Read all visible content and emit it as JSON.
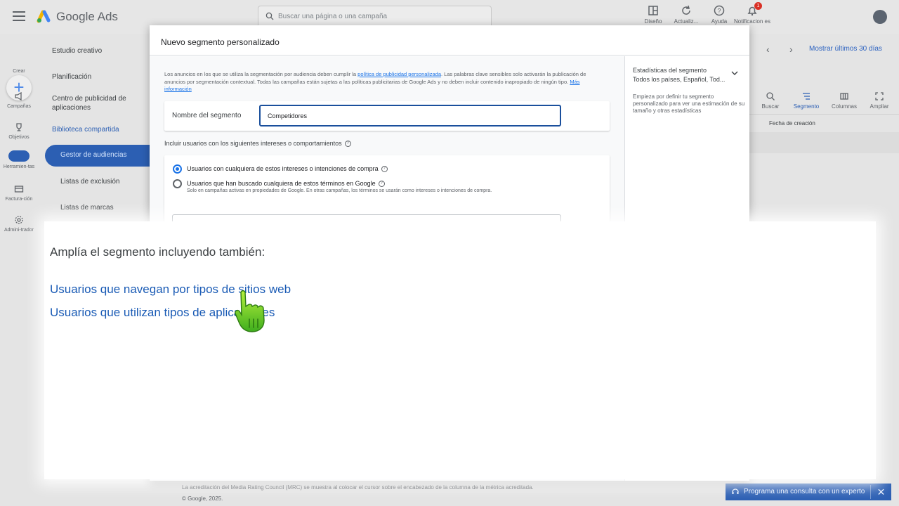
{
  "topbar": {
    "brand": "Google Ads",
    "search_placeholder": "Buscar una página o una campaña",
    "items": [
      {
        "label": "Diseño",
        "icon": "layout-icon"
      },
      {
        "label": "Actualiz...",
        "icon": "refresh-icon"
      },
      {
        "label": "Ayuda",
        "icon": "help-icon"
      },
      {
        "label": "Notificacion es",
        "icon": "bell-icon",
        "badge": "1"
      }
    ]
  },
  "rail": {
    "create": "Crear",
    "items": [
      {
        "label": "Campañas",
        "icon": "megaphone-icon"
      },
      {
        "label": "Objetivos",
        "icon": "trophy-icon"
      },
      {
        "label": "Herramien-tas",
        "icon": "tools-icon"
      },
      {
        "label": "Factura-ción",
        "icon": "credit-card-icon"
      },
      {
        "label": "Admini-trador",
        "icon": "gear-icon"
      }
    ]
  },
  "nav": {
    "studio": "Estudio creativo",
    "planning": "Planificación",
    "app_center_1": "Centro de publicidad de",
    "app_center_2": "aplicaciones",
    "shared_library": "Biblioteca compartida",
    "audience_manager": "Gestor de audiencias",
    "exclusion_lists": "Listas de exclusión",
    "brand_lists": "Listas de marcas"
  },
  "right": {
    "date_range": "Mostrar últimos 30 días",
    "tools": [
      "Buscar",
      "Segmento",
      "Columnas",
      "Ampliar"
    ],
    "column_header": "Fecha de creación"
  },
  "footer": {
    "line1": "La acreditación del Media Rating Council (MRC) se muestra al colocar el cursor sobre el encabezado de la columna de la métrica acreditada.",
    "line2": "© Google, 2025."
  },
  "consult": {
    "label": "Programa una consulta con un experto",
    "close": "✕"
  },
  "dialog": {
    "title": "Nuevo segmento personalizado",
    "policy": {
      "pre": "Los anuncios en los que se utiliza la segmentación por audiencia deben cumplir la ",
      "link1": "política de publicidad personalizada",
      "mid": ". Las palabras clave sensibles solo activarán la publicación de anuncios por segmentación contextual. Todas las campañas están sujetas a las políticas publicitarias de Google Ads y no deben incluir contenido inapropiado de ningún tipo. ",
      "link2": "Más información"
    },
    "name_label": "Nombre del segmento",
    "name_value": "Competidores",
    "include_label": "Incluir usuarios con los siguientes intereses o comportamientos",
    "option1": "Usuarios con cualquiera de estos intereses o intenciones de compra",
    "option2": "Usuarios que han buscado cualquiera de estos términos en Google",
    "option2_note": "Solo en campañas activas en propiedades de Google. En otras campañas, los términos se usarán como intereses o intenciones de compra.",
    "stats": {
      "title": "Estadísticas del segmento",
      "subtitle": "Todos los países, Español, Tod...",
      "description": "Empieza por definir tu segmento personalizado para ver una estimación de su tamaño y otras estadísticas"
    }
  },
  "zoom": {
    "title": "Amplía el segmento incluyendo también:",
    "link1": "Usuarios que navegan por tipos de sitios web",
    "link2": "Usuarios que utilizan tipos de aplicaciones"
  },
  "colors": {
    "accent": "#1a73e8",
    "brand_dark": "#2c5fb3",
    "link": "#1a5bb5"
  }
}
